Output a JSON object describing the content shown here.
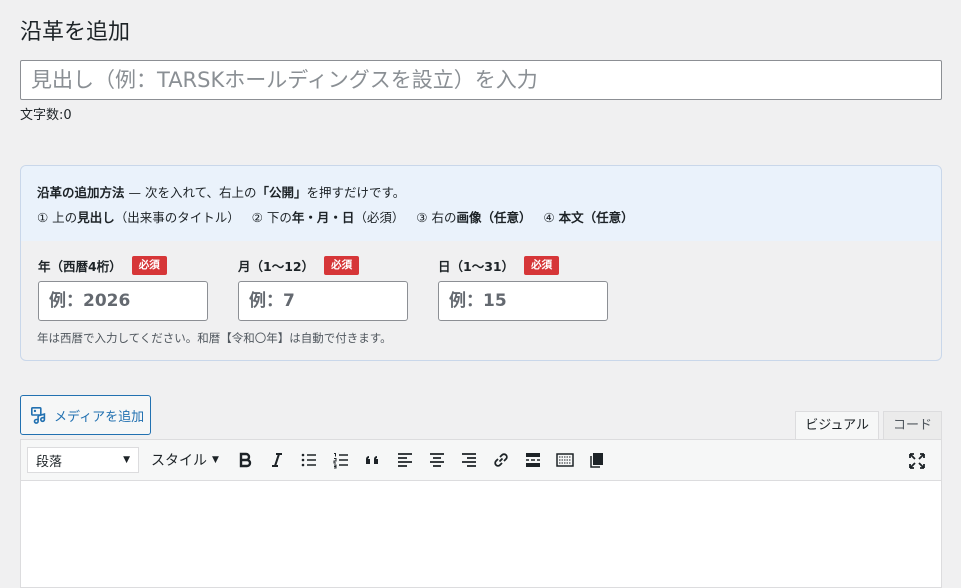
{
  "page": {
    "title": "沿革を追加"
  },
  "title_field": {
    "placeholder": "見出し（例：TARSKホールディングスを設立）を入力"
  },
  "char_count": {
    "label": "文字数:",
    "value": "0"
  },
  "info": {
    "line1": {
      "a": "沿革の追加方法",
      "b": " — 次を入れて、右上の",
      "c": "「公開」",
      "d": "を押すだけです。"
    },
    "line2": {
      "s1_num": "① 上の",
      "s1_bold": "見出し",
      "s1_rest": "（出来事のタイトル）",
      "s2_num": "② 下の",
      "s2_bold": "年・月・日",
      "s2_rest": "（必須）",
      "s3_num": "③ 右の",
      "s3_bold": "画像（任意）",
      "s4_num": "④ ",
      "s4_bold": "本文（任意）"
    }
  },
  "fields": {
    "year": {
      "label": "年（西暦4桁）",
      "badge": "必須",
      "placeholder": "例：2026"
    },
    "month": {
      "label": "月（1〜12）",
      "badge": "必須",
      "placeholder": "例：7"
    },
    "day": {
      "label": "日（1〜31）",
      "badge": "必須",
      "placeholder": "例：15"
    },
    "helper": "年は西暦で入力してください。和暦【令和〇年】は自動で付きます。"
  },
  "media_button": {
    "label": "メディアを追加",
    "icon": "media-icon"
  },
  "editor": {
    "tabs": [
      "ビジュアル",
      "コード"
    ],
    "active_tab": "ビジュアル",
    "format_select": "段落",
    "style_label": "スタイル",
    "buttons": [
      "bold",
      "italic",
      "bullet-list",
      "numbered-list",
      "blockquote",
      "align-left",
      "align-center",
      "align-right",
      "link",
      "read-more",
      "toolbar-toggle",
      "copy"
    ]
  },
  "colors": {
    "accent": "#2271b1",
    "required": "#d63638",
    "info_bg": "#eaf2fb",
    "page_bg": "#f0f0f1"
  }
}
